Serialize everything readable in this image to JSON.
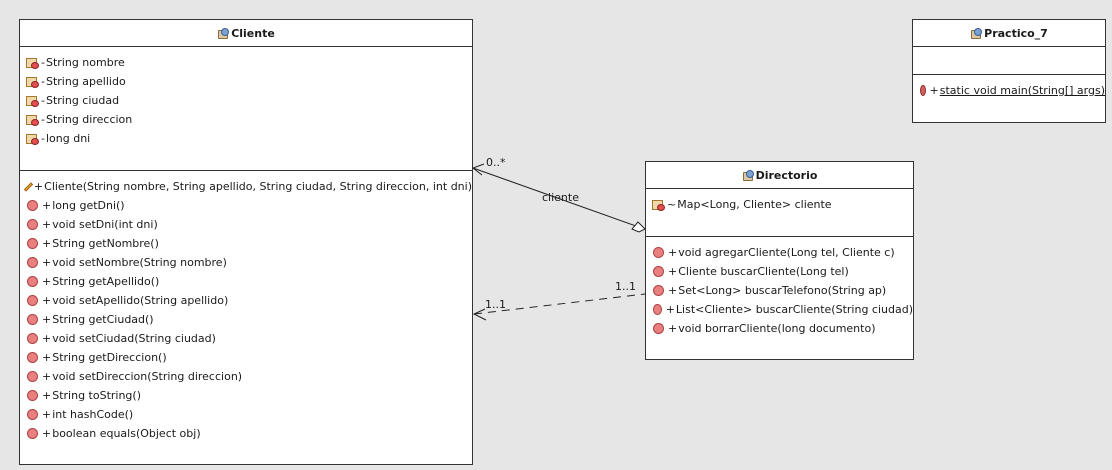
{
  "classes": {
    "cliente": {
      "name": "Cliente",
      "fields": [
        {
          "vis": "-",
          "text": "String nombre"
        },
        {
          "vis": "-",
          "text": "String apellido"
        },
        {
          "vis": "-",
          "text": "String ciudad"
        },
        {
          "vis": "-",
          "text": "String direccion"
        },
        {
          "vis": "-",
          "text": "long dni"
        }
      ],
      "methods": [
        {
          "vis": "+",
          "kind": "constructor",
          "text": "Cliente(String nombre, String apellido, String ciudad, String direccion, int dni)"
        },
        {
          "vis": "+",
          "kind": "method",
          "text": "long getDni()"
        },
        {
          "vis": "+",
          "kind": "method",
          "text": "void setDni(int dni)"
        },
        {
          "vis": "+",
          "kind": "method",
          "text": "String getNombre()"
        },
        {
          "vis": "+",
          "kind": "method",
          "text": "void setNombre(String nombre)"
        },
        {
          "vis": "+",
          "kind": "method",
          "text": "String getApellido()"
        },
        {
          "vis": "+",
          "kind": "method",
          "text": "void setApellido(String apellido)"
        },
        {
          "vis": "+",
          "kind": "method",
          "text": "String getCiudad()"
        },
        {
          "vis": "+",
          "kind": "method",
          "text": "void setCiudad(String ciudad)"
        },
        {
          "vis": "+",
          "kind": "method",
          "text": "String getDireccion()"
        },
        {
          "vis": "+",
          "kind": "method",
          "text": "void setDireccion(String direccion)"
        },
        {
          "vis": "+",
          "kind": "method",
          "text": "String toString()"
        },
        {
          "vis": "+",
          "kind": "method",
          "text": "int hashCode()"
        },
        {
          "vis": "+",
          "kind": "method",
          "text": "boolean equals(Object obj)"
        }
      ]
    },
    "practico": {
      "name": "Practico_7",
      "fields": [],
      "methods": [
        {
          "vis": "+",
          "kind": "static",
          "text": "static void main(String[] args)"
        }
      ]
    },
    "directorio": {
      "name": "Directorio",
      "fields": [
        {
          "vis": "~",
          "text": "Map<Long, Cliente> cliente"
        }
      ],
      "methods": [
        {
          "vis": "+",
          "kind": "method",
          "text": "void agregarCliente(Long tel, Cliente c)"
        },
        {
          "vis": "+",
          "kind": "method",
          "text": "Cliente buscarCliente(Long tel)"
        },
        {
          "vis": "+",
          "kind": "method",
          "text": "Set<Long> buscarTelefono(String ap)"
        },
        {
          "vis": "+",
          "kind": "method",
          "text": "List<Cliente> buscarCliente(String ciudad)"
        },
        {
          "vis": "+",
          "kind": "method",
          "text": "void borrarCliente(long documento)"
        }
      ]
    }
  },
  "associations": {
    "aggregation": {
      "role": "cliente",
      "multiplicity_target": "0..*"
    },
    "dependency": {
      "multiplicity_source": "1..1",
      "multiplicity_target": "1..1"
    }
  },
  "icons": {
    "class": "class-icon",
    "field": "field-icon",
    "method": "method-icon",
    "constructor": "constructor-icon",
    "static": "static-method-icon"
  },
  "colors": {
    "background": "#e6e6e6",
    "box": "#ffffff",
    "border": "#333333"
  }
}
